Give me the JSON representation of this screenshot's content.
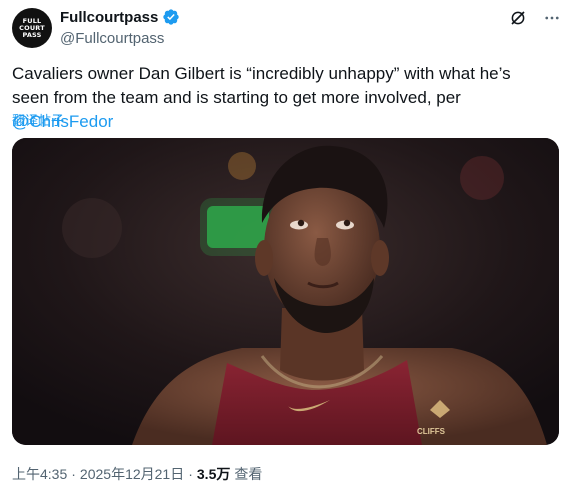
{
  "account": {
    "display_name": "Fullcourtpass",
    "handle": "@Fullcourtpass",
    "avatar_lines": [
      "FULL",
      "COURT",
      "PASS"
    ],
    "verified_color": "#1d9bf0"
  },
  "tweet": {
    "text_main": "Cavaliers owner Dan Gilbert is “incredibly unhappy” with what he’s seen from the team and is starting to get more involved, per ",
    "mention": "@ChrisFedor",
    "translate_label": "翻译帖子"
  },
  "media": {
    "jersey_text": "CLIFFS",
    "jersey_color": "#7a1f2b"
  },
  "meta": {
    "time": "上午4:35",
    "date": "2025年12月21日",
    "separator1": "·",
    "separator2": "·",
    "views_count": "3.5万",
    "views_label": "查看"
  },
  "icons": [
    "grok-icon",
    "more-icon",
    "verified-icon"
  ],
  "colors": {
    "link": "#1d9bf0",
    "secondary_text": "#536471",
    "text": "#0f1419"
  }
}
